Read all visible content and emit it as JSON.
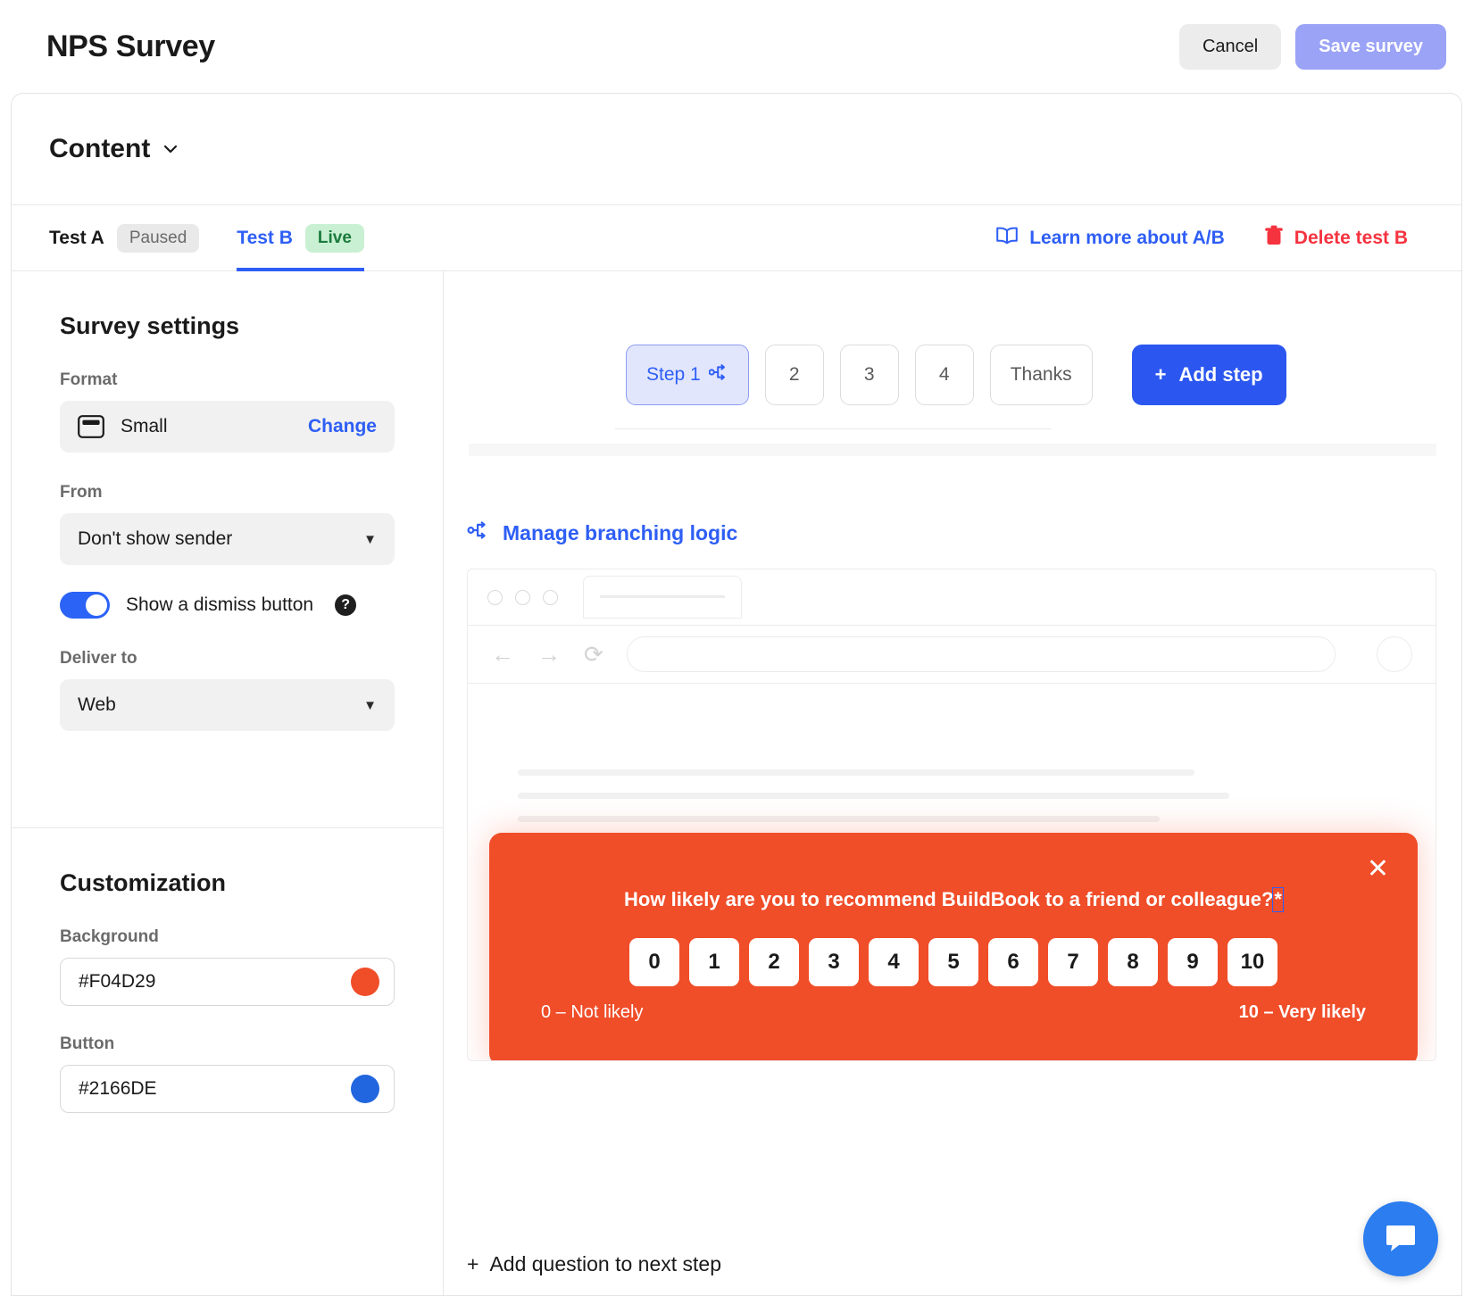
{
  "header": {
    "title": "NPS Survey",
    "cancel_label": "Cancel",
    "save_label": "Save survey"
  },
  "content_section": {
    "title": "Content"
  },
  "ab_bar": {
    "test_a_label": "Test A",
    "test_a_status": "Paused",
    "test_b_label": "Test B",
    "test_b_status": "Live",
    "learn_more_label": "Learn more about A/B",
    "delete_label": "Delete test B"
  },
  "sidebar": {
    "survey_settings_title": "Survey settings",
    "format_label": "Format",
    "format_value": "Small",
    "format_change": "Change",
    "from_label": "From",
    "from_value": "Don't show sender",
    "dismiss_toggle_label": "Show a dismiss button",
    "help_glyph": "?",
    "deliver_label": "Deliver to",
    "deliver_value": "Web",
    "customization_title": "Customization",
    "background_label": "Background",
    "background_value": "#F04D29",
    "background_color": "#F04D29",
    "button_label": "Button",
    "button_value": "#2166DE",
    "button_color": "#2166DE"
  },
  "steps": {
    "items": [
      {
        "label": "Step 1",
        "branching": true
      },
      {
        "label": "2",
        "branching": false
      },
      {
        "label": "3",
        "branching": false
      },
      {
        "label": "4",
        "branching": false
      },
      {
        "label": "Thanks",
        "branching": false
      }
    ],
    "add_step_label": "Add step",
    "add_step_glyph": "+"
  },
  "branching": {
    "link_label": "Manage branching logic"
  },
  "preview": {
    "question": "How likely are you to recommend BuildBook to a friend or colleague?",
    "required_marker": "*",
    "scale": [
      "0",
      "1",
      "2",
      "3",
      "4",
      "5",
      "6",
      "7",
      "8",
      "9",
      "10"
    ],
    "low_label": "0 – Not likely",
    "high_label": "10 – Very likely",
    "background_color": "#F04D29",
    "close_glyph": "✕"
  },
  "footer": {
    "add_question_label": "Add question to next step",
    "add_question_glyph": "+"
  }
}
